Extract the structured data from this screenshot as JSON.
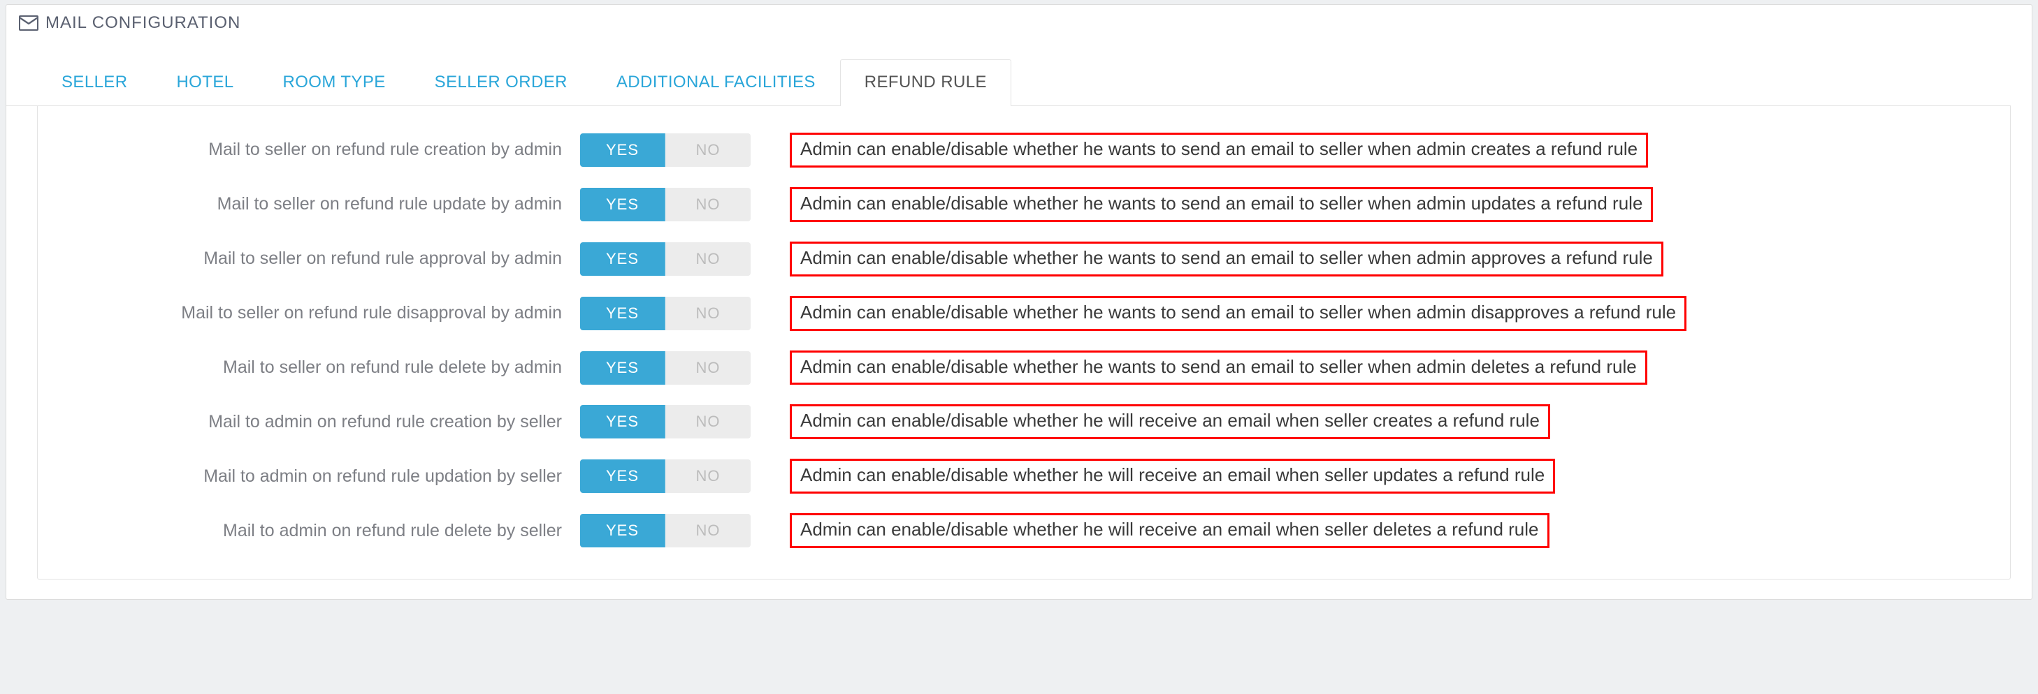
{
  "panel": {
    "title": "MAIL CONFIGURATION"
  },
  "tabs": [
    {
      "id": "seller",
      "label": "SELLER",
      "active": false
    },
    {
      "id": "hotel",
      "label": "HOTEL",
      "active": false
    },
    {
      "id": "room-type",
      "label": "ROOM TYPE",
      "active": false
    },
    {
      "id": "seller-order",
      "label": "SELLER ORDER",
      "active": false
    },
    {
      "id": "additional",
      "label": "ADDITIONAL FACILITIES",
      "active": false
    },
    {
      "id": "refund",
      "label": "REFUND RULE",
      "active": true
    }
  ],
  "toggle": {
    "yes": "YES",
    "no": "NO"
  },
  "rows": [
    {
      "label": "Mail to seller on refund rule creation by admin",
      "value": "YES",
      "desc": "Admin can enable/disable whether he wants to send an email to seller when admin creates a refund rule"
    },
    {
      "label": "Mail to seller on refund rule update by admin",
      "value": "YES",
      "desc": "Admin can enable/disable whether he wants to send an email to seller when admin updates a refund rule"
    },
    {
      "label": "Mail to seller on refund rule approval by admin",
      "value": "YES",
      "desc": "Admin can enable/disable whether he wants to send an email to seller when admin approves a refund rule"
    },
    {
      "label": "Mail to seller on refund rule disapproval by admin",
      "value": "YES",
      "desc": "Admin can enable/disable whether he wants to send an email to seller when admin disapproves a refund rule"
    },
    {
      "label": "Mail to seller on refund rule delete by admin",
      "value": "YES",
      "desc": "Admin can enable/disable whether he wants to send an email to seller when admin deletes a refund rule"
    },
    {
      "label": "Mail to admin on refund rule creation by seller",
      "value": "YES",
      "desc": "Admin can enable/disable whether he will receive an email when seller creates a refund rule"
    },
    {
      "label": "Mail to admin on refund rule updation by seller",
      "value": "YES",
      "desc": "Admin can enable/disable whether he will receive an email when seller updates a refund rule"
    },
    {
      "label": "Mail to admin on refund rule delete by seller",
      "value": "YES",
      "desc": "Admin can enable/disable whether he will receive an email when seller deletes a refund rule"
    }
  ]
}
